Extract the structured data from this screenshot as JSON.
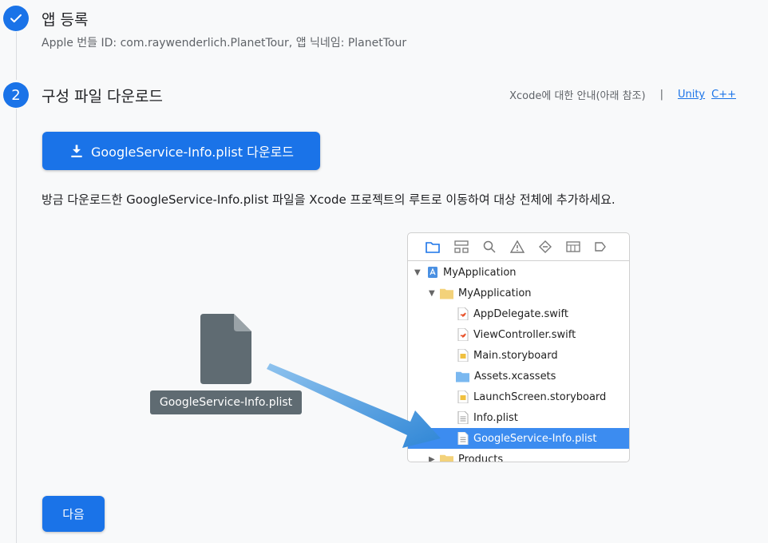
{
  "step1": {
    "title": "앱 등록",
    "subtitle": "Apple 번들 ID: com.raywenderlich.PlanetTour, 앱 닉네임: PlanetTour"
  },
  "step2": {
    "number": "2",
    "title": "구성 파일 다운로드",
    "xcode_note": "Xcode에 대한 안내(아래 참조)",
    "separator": "|",
    "links": [
      "Unity",
      "C++"
    ],
    "download_button": "GoogleService-Info.plist 다운로드",
    "instruction": "방금 다운로드한 GoogleService-Info.plist 파일을 Xcode 프로젝트의 루트로 이동하여 대상 전체에 추가하세요."
  },
  "illustration": {
    "file_label": "GoogleService-Info.plist",
    "tree": [
      {
        "label": "MyApplication",
        "icon": "project-icon",
        "indent": 0,
        "expanded": true
      },
      {
        "label": "MyApplication",
        "icon": "folder-icon",
        "indent": 1,
        "expanded": true
      },
      {
        "label": "AppDelegate.swift",
        "icon": "swift-file-icon",
        "indent": 2
      },
      {
        "label": "ViewController.swift",
        "icon": "swift-file-icon",
        "indent": 2
      },
      {
        "label": "Main.storyboard",
        "icon": "storyboard-icon",
        "indent": 2
      },
      {
        "label": "Assets.xcassets",
        "icon": "assets-folder-icon",
        "indent": 2
      },
      {
        "label": "LaunchScreen.storyboard",
        "icon": "storyboard-icon",
        "indent": 2
      },
      {
        "label": "Info.plist",
        "icon": "plist-icon",
        "indent": 2
      },
      {
        "label": "GoogleService-Info.plist",
        "icon": "plist-icon",
        "indent": 2,
        "selected": true
      },
      {
        "label": "Products",
        "icon": "folder-icon",
        "indent": 1,
        "expanded": false
      }
    ]
  },
  "next_button": "다음",
  "colors": {
    "accent": "#1a73e8",
    "selection": "#3c8cf0",
    "arrow": "#3b8fd9"
  }
}
